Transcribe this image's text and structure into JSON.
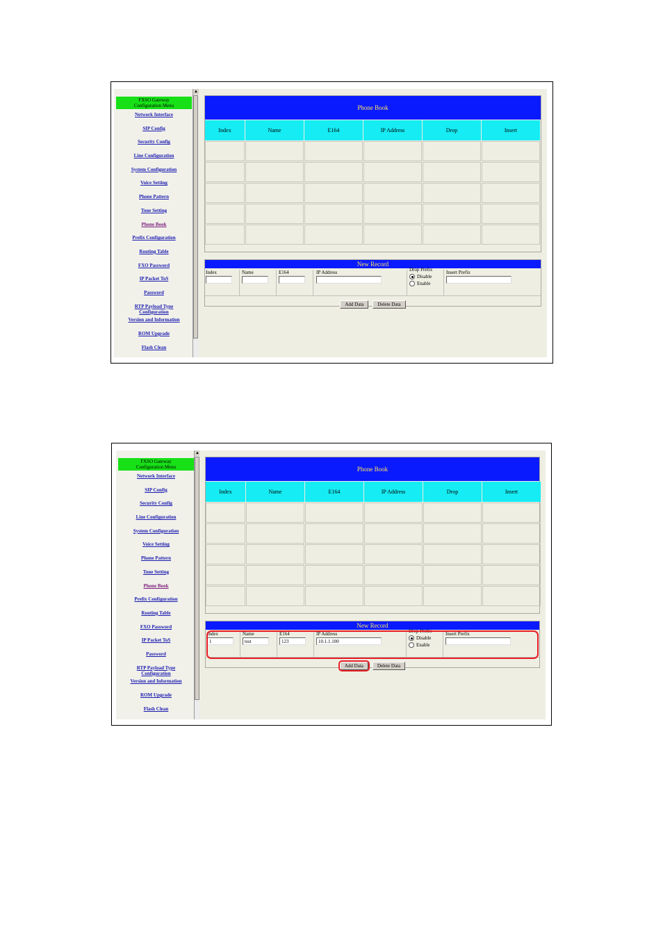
{
  "menu": {
    "title_line1": "FXSO Gateway",
    "title_line2": "Configuration Menu",
    "items": [
      {
        "label": "Network Interface"
      },
      {
        "label": "SIP Config"
      },
      {
        "label": "Security Config"
      },
      {
        "label": "Line Configuration"
      },
      {
        "label": "System Configuration"
      },
      {
        "label": "Voice Setting"
      },
      {
        "label": "Phone Pattern"
      },
      {
        "label": "Tone Setting"
      },
      {
        "label": "Phone Book"
      },
      {
        "label": "Prefix Configuration"
      },
      {
        "label": "Routing Table"
      },
      {
        "label": "FXO Password"
      },
      {
        "label": "IP Packet ToS"
      },
      {
        "label": "Password"
      },
      {
        "label": "RTP Payload Type",
        "label2": "Configuration"
      },
      {
        "label": "Version and Information"
      },
      {
        "label": "ROM Upgrade"
      },
      {
        "label": "Flash Clean"
      }
    ]
  },
  "phone_book": {
    "title": "Phone Book",
    "columns": [
      "Index",
      "Name",
      "E164",
      "IP Address",
      "Drop",
      "Insert"
    ]
  },
  "new_record": {
    "title": "New Record",
    "labels": {
      "index": "Index",
      "name": "Name",
      "e164": "E164",
      "ip": "IP Address",
      "drop_prefix": "Drop Prefix",
      "disable": "Disable",
      "enable": "Enable",
      "insert_prefix": "Insert Prefix"
    },
    "add_button": "Add Data",
    "delete_button": "Delete Data"
  },
  "screen2_values": {
    "index": "1",
    "name": "test",
    "e164": "123",
    "ip": "10.1.1.100",
    "insert_prefix": ""
  }
}
